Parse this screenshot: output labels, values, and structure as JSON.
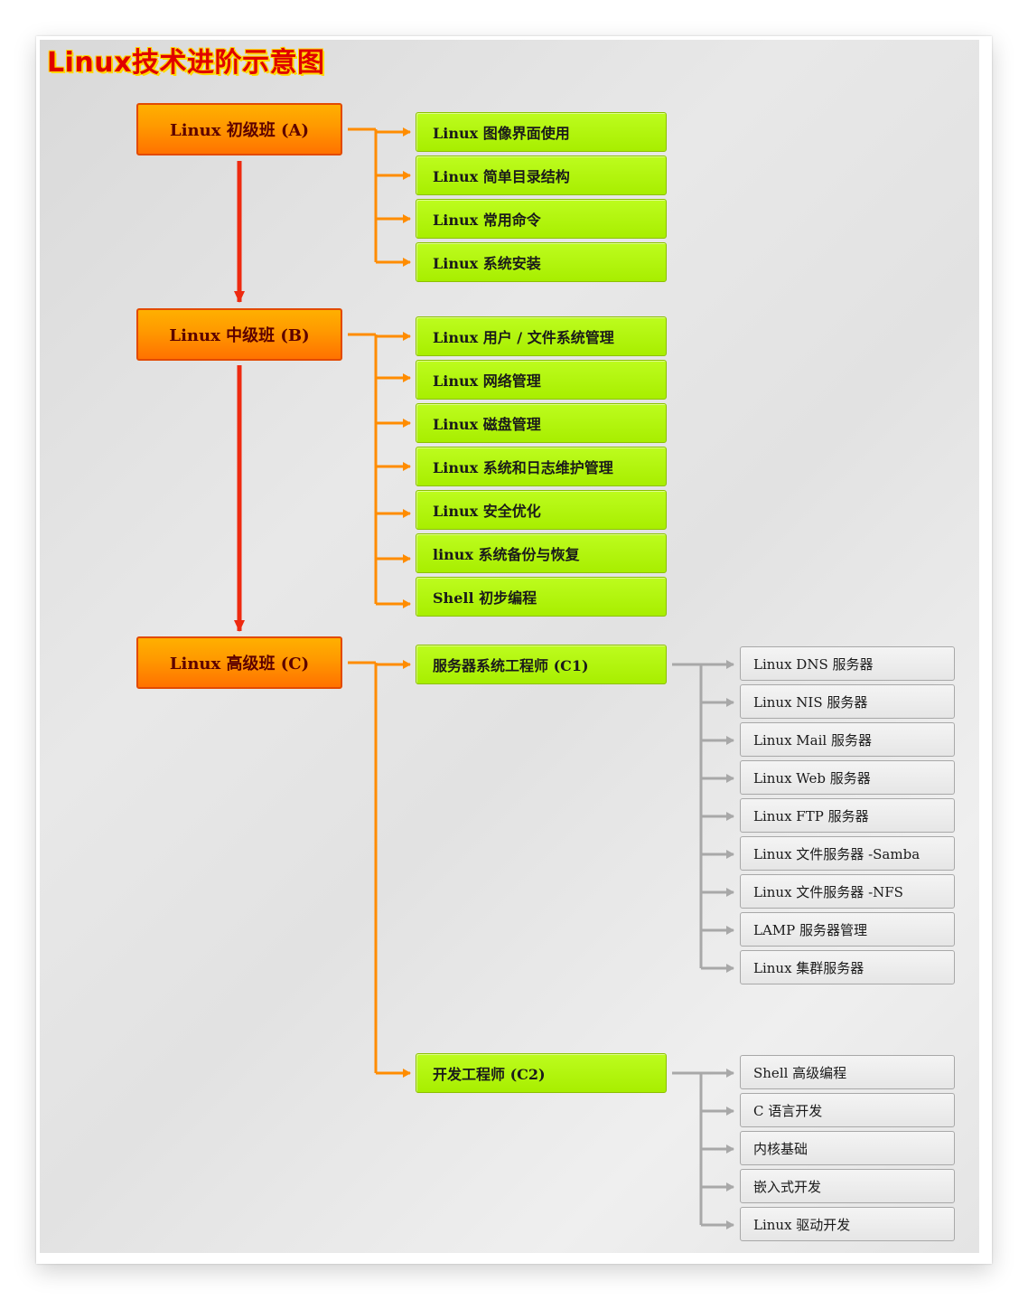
{
  "title": "Linux技术进阶示意图",
  "levels": [
    {
      "label": "Linux 初级班 (A)",
      "items": [
        "Linux 图像界面使用",
        "Linux 简单目录结构",
        "Linux 常用命令",
        "Linux 系统安装"
      ]
    },
    {
      "label": "Linux 中级班 (B)",
      "items": [
        "Linux 用户 / 文件系统管理",
        "Linux 网络管理",
        "Linux 磁盘管理",
        "Linux 系统和日志维护管理",
        "Linux 安全优化",
        "linux 系统备份与恢复",
        "Shell 初步编程"
      ]
    },
    {
      "label": "Linux 高级班 (C)",
      "tracks": [
        {
          "label": "服务器系统工程师 (C1)",
          "items": [
            "Linux DNS 服务器",
            "Linux NIS 服务器",
            "Linux Mail 服务器",
            "Linux Web 服务器",
            "Linux FTP 服务器",
            "Linux 文件服务器 -Samba",
            "Linux 文件服务器 -NFS",
            "LAMP 服务器管理",
            "Linux 集群服务器"
          ]
        },
        {
          "label": "开发工程师 (C2)",
          "items": [
            "Shell 高级编程",
            "C 语言开发",
            "内核基础",
            "嵌入式开发",
            "Linux 驱动开发"
          ]
        }
      ]
    }
  ],
  "colors": {
    "level_fill": "#ff9800",
    "level_border": "#e24a00",
    "item_fill": "#a8ee00",
    "sub_fill": "#eeeeee",
    "connector_orange": "#ff8c00",
    "connector_red": "#ee2a10",
    "connector_gray": "#a8a8a8",
    "title_color": "#e00000"
  }
}
